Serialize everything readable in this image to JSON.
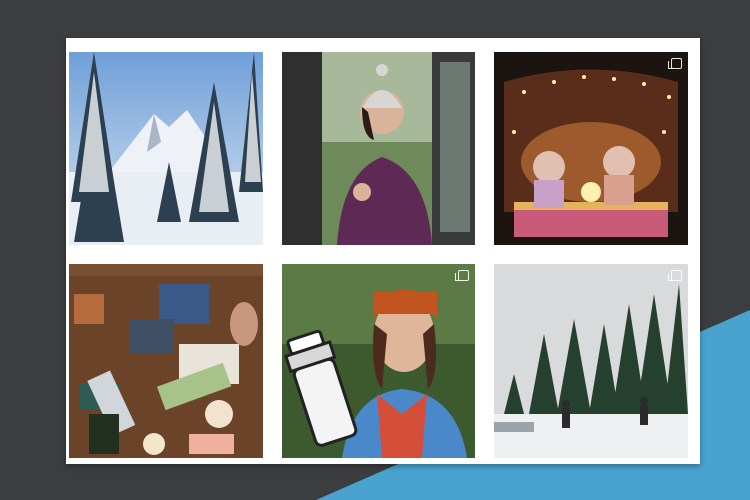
{
  "colors": {
    "background": "#3c3d3f",
    "accent": "#4aa3cf",
    "card": "#ffffff"
  },
  "grid": {
    "posts": [
      {
        "id": "post-1",
        "subject": "snowy-mountain-forest"
      },
      {
        "id": "post-2",
        "subject": "woman-purple-jacket-beanie"
      },
      {
        "id": "post-3",
        "subject": "kids-in-van-with-lights",
        "icon": "multiple-images-icon"
      },
      {
        "id": "post-4",
        "subject": "gift-wrapping-supplies"
      },
      {
        "id": "post-5",
        "subject": "woman-with-shaker-sticker",
        "icon": "multiple-images-icon"
      },
      {
        "id": "post-6",
        "subject": "snowshoe-hikers-forest",
        "icon": "multiple-images-icon"
      }
    ]
  }
}
